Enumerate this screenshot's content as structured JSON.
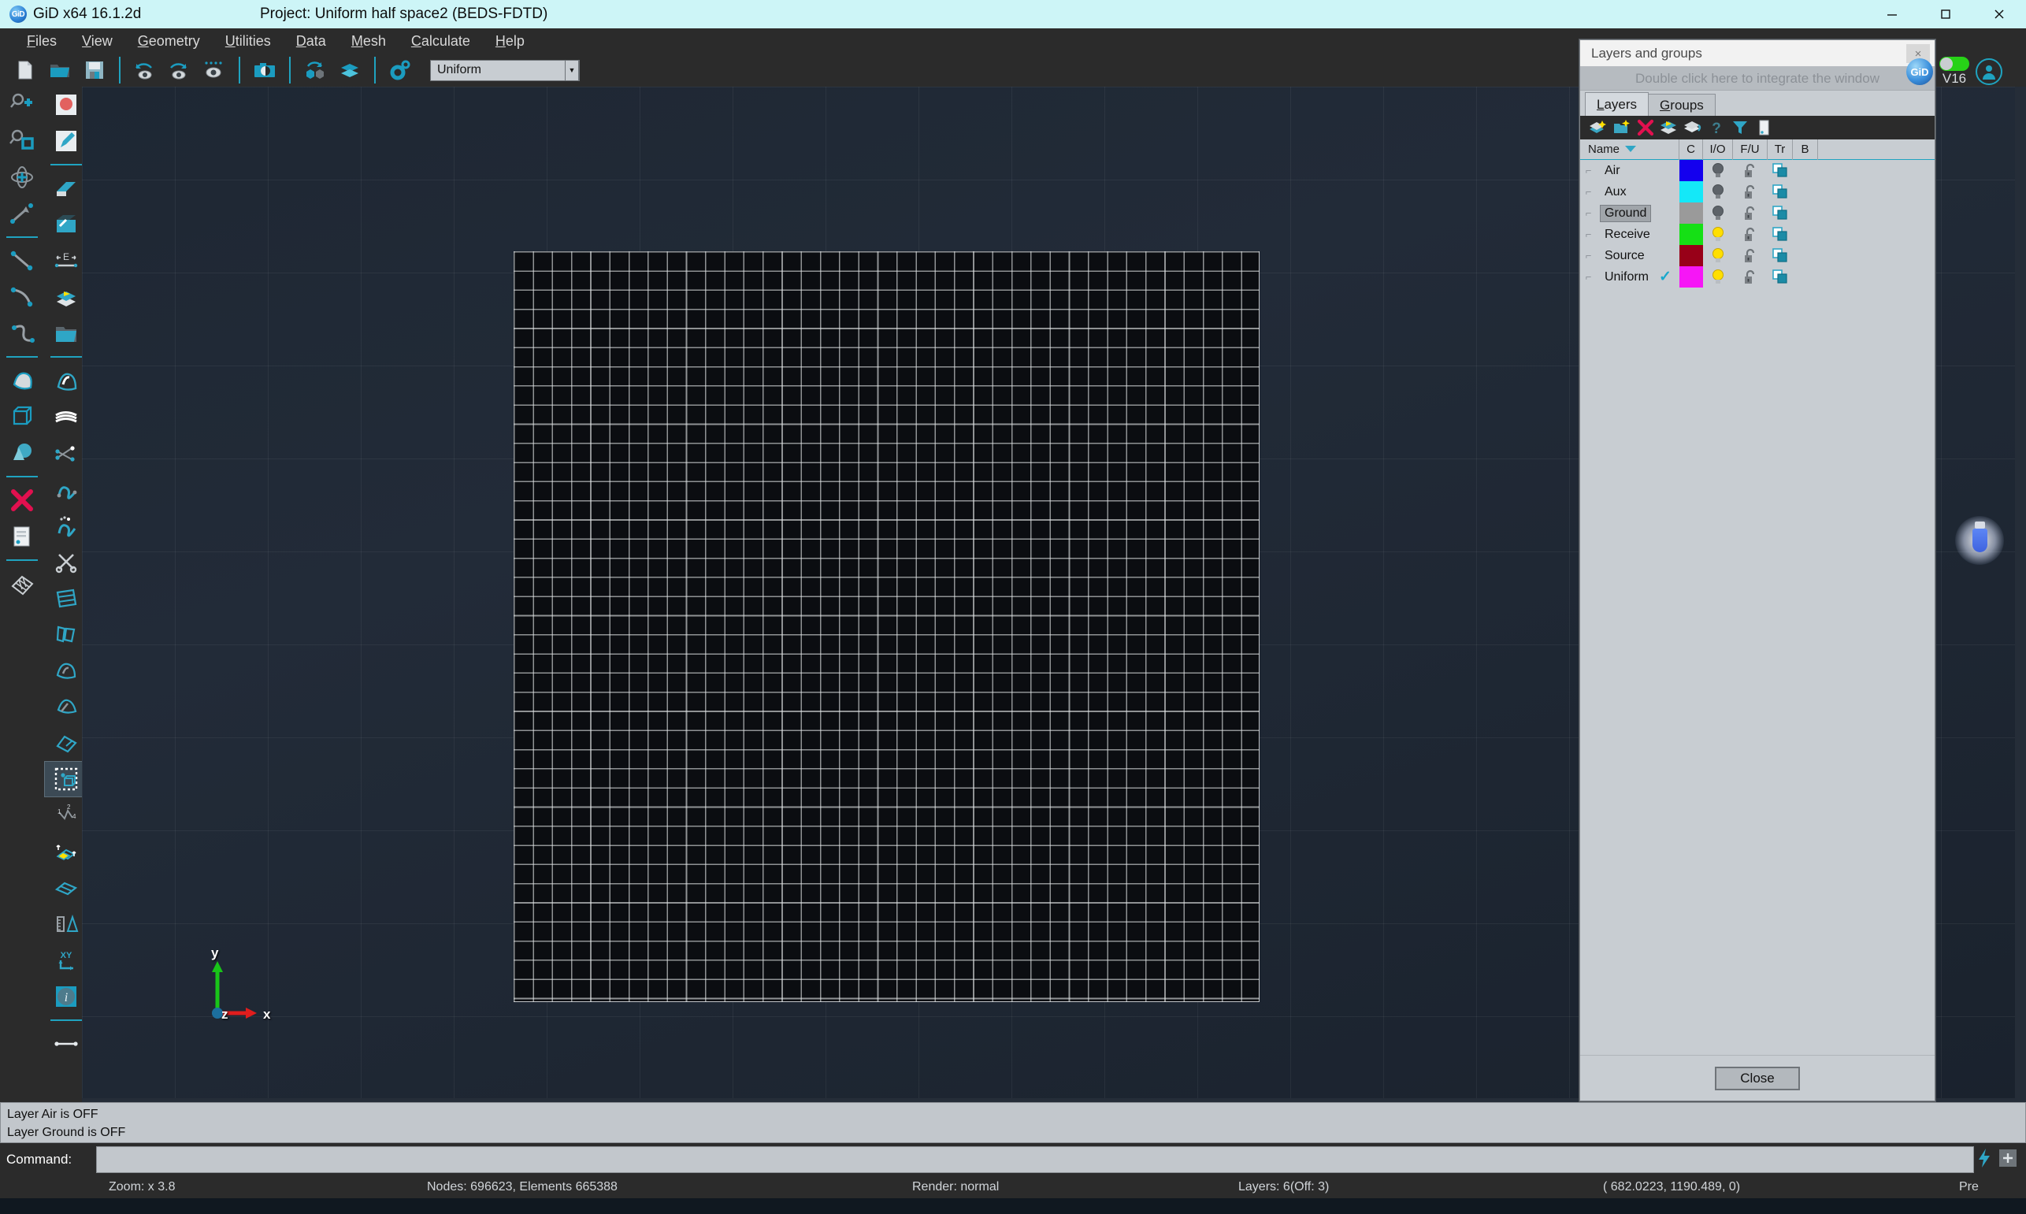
{
  "titlebar": {
    "logo": "GiD",
    "app_title": "GiD x64 16.1.2d",
    "project_title": "Project: Uniform half space2 (BEDS-FDTD)",
    "minimize": "minimize-icon",
    "maximize": "maximize-icon",
    "close": "close-icon"
  },
  "menubar": {
    "items": [
      {
        "label": "Files",
        "mnemonic": "F"
      },
      {
        "label": "View",
        "mnemonic": "V"
      },
      {
        "label": "Geometry",
        "mnemonic": "G"
      },
      {
        "label": "Utilities",
        "mnemonic": "U"
      },
      {
        "label": "Data",
        "mnemonic": "D"
      },
      {
        "label": "Mesh",
        "mnemonic": "M"
      },
      {
        "label": "Calculate",
        "mnemonic": "C"
      },
      {
        "label": "Help",
        "mnemonic": "H"
      }
    ]
  },
  "toolbar": {
    "icons": [
      "new-file-icon",
      "open-folder-icon",
      "save-icon",
      "zoom-previous-icon",
      "zoom-next-icon",
      "redraw-icon",
      "snapshot-icon",
      "rotate-view-icon",
      "layers-icon",
      "preferences-icon"
    ],
    "mesh_combo": {
      "value": "Uniform",
      "placeholder": "Uniform",
      "chevron": "chevron-down-icon"
    }
  },
  "left_toolbar_a": {
    "icons": [
      "zoom-in-icon",
      "zoom-window-icon",
      "rotate-trackball-icon",
      "pan-icon",
      "line-icon",
      "arc-icon",
      "nurbs-curve-icon",
      "surface-icon",
      "volume-cube-icon",
      "primitive-solids-icon",
      "delete-x-icon",
      "list-entities-icon",
      "mesh-surface-icon"
    ]
  },
  "left_toolbar_b": {
    "icons": [
      "point-red-icon",
      "draw-pencil-icon",
      "nurbs-surface-icon",
      "contour-surface-icon",
      "edge-extend-icon",
      "layer-move-icon",
      "open-layer-icon",
      "surface-create-icon",
      "surface-cone-icon",
      "coons-surface-icon",
      "intersect-lines-icon",
      "line-join-icon",
      "split-curve-icon",
      "scissors-cut-icon",
      "quad-mesh-icon",
      "mesh-structured-icon",
      "surface-mesh-icon",
      "cone-mesh-icon",
      "mesh-edit-icon",
      "select-box-icon",
      "node-order-icon",
      "extrude-icon",
      "skew-surface-icon",
      "measure-icon",
      "axes-xy-icon",
      "info-icon",
      "distance-icon"
    ],
    "selected_index": 20
  },
  "canvas": {
    "axes": {
      "x_label": "x",
      "y_label": "y",
      "z_label": "z"
    },
    "dongle": "usb-dongle-icon"
  },
  "gid_brand": {
    "logo": "GiD",
    "version": "V16",
    "toggle": "license-toggle",
    "user": "user-account-icon"
  },
  "panel": {
    "title": "Layers and groups",
    "close_icon": "panel-close-icon",
    "integrate_hint": "Double click here to integrate the window",
    "tabs": [
      {
        "label": "Layers",
        "mnemonic": "L",
        "active": true
      },
      {
        "label": "Groups",
        "mnemonic": "G",
        "active": false
      }
    ],
    "toolbar_icons": [
      "new-layer-icon",
      "new-layer-folder-icon",
      "delete-layer-icon",
      "send-to-layer-icon",
      "layer-properties-icon",
      "unknown-layer-icon",
      "filter-layers-icon",
      "layer-list-icon"
    ],
    "columns": [
      {
        "key": "name",
        "label": "Name",
        "sort": "descending"
      },
      {
        "key": "c",
        "label": "C"
      },
      {
        "key": "io",
        "label": "I/O"
      },
      {
        "key": "fu",
        "label": "F/U"
      },
      {
        "key": "tr",
        "label": "Tr"
      },
      {
        "key": "b",
        "label": "B"
      }
    ],
    "rows": [
      {
        "name": "Air",
        "color": "#1400ee",
        "bulb": "off",
        "lock": "unlocked",
        "transparency": "on",
        "selected": false,
        "current": false
      },
      {
        "name": "Aux",
        "color": "#14e8f8",
        "bulb": "off",
        "lock": "unlocked",
        "transparency": "on",
        "selected": false,
        "current": false
      },
      {
        "name": "Ground",
        "color": "#9a9a9a",
        "bulb": "off",
        "lock": "unlocked",
        "transparency": "on",
        "selected": true,
        "current": false
      },
      {
        "name": "Receive",
        "color": "#15e015",
        "bulb": "on",
        "lock": "unlocked",
        "transparency": "on",
        "selected": false,
        "current": false
      },
      {
        "name": "Source",
        "color": "#980018",
        "bulb": "on",
        "lock": "unlocked",
        "transparency": "on",
        "selected": false,
        "current": false
      },
      {
        "name": "Uniform",
        "color": "#f616f6",
        "bulb": "on",
        "lock": "unlocked",
        "transparency": "on",
        "selected": false,
        "current": true
      }
    ],
    "close_button": "Close"
  },
  "log": {
    "lines": [
      "Layer Air is OFF",
      "Layer Ground is OFF"
    ]
  },
  "command": {
    "label": "Command:",
    "value": "",
    "placeholder": "",
    "icons": [
      "lightning-icon",
      "toggle-icon"
    ]
  },
  "statusbar": {
    "zoom": "Zoom: x 3.8",
    "counts": "Nodes: 696623, Elements 665388",
    "render": "Render: normal",
    "layers": "Layers: 6(Off: 3)",
    "coords": "( 682.0223,  1190.489,  0)",
    "mode": "Pre"
  },
  "colors": {
    "titlebar_bg": "#cdf5f7",
    "chrome_bg": "#2b2b2b",
    "accent": "#1fa3c0",
    "panel_bg": "#c8cdd2",
    "canvas_bg": "#1e2733"
  }
}
